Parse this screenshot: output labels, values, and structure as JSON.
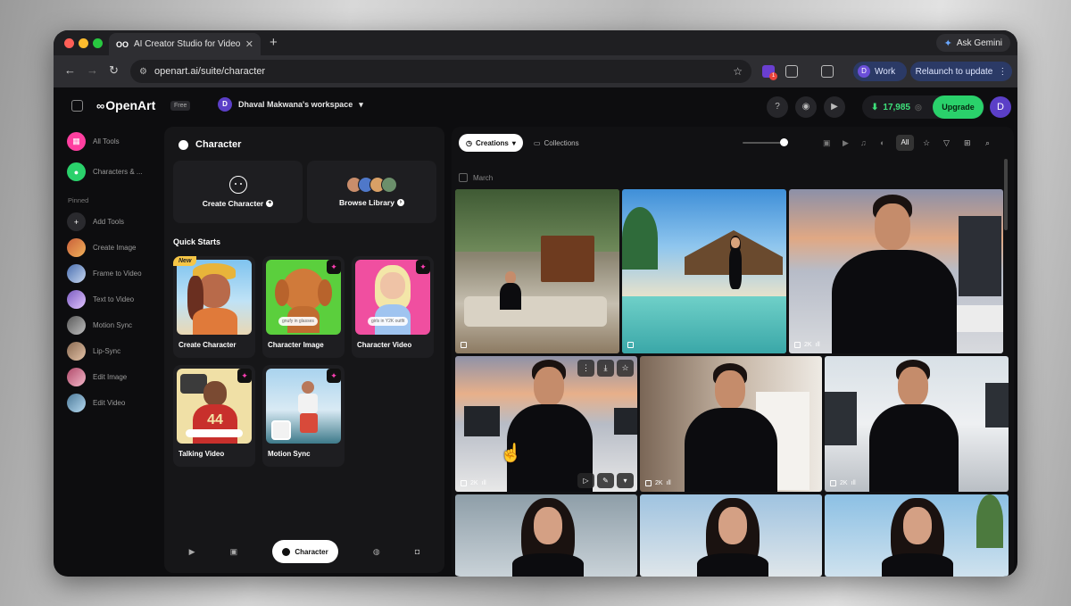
{
  "browser": {
    "tab_title": "AI Creator Studio for Video &",
    "tab_favicon": "OO",
    "url": "openart.ai/suite/character",
    "gemini_label": "Ask Gemini",
    "profile_initial": "D",
    "profile_label": "Work",
    "relaunch_label": "Relaunch to update",
    "ext_badge": "1"
  },
  "app": {
    "logo": "OpenArt",
    "plan_badge": "Free",
    "workspace_initial": "D",
    "workspace_name": "Dhaval Makwana's workspace",
    "credits": "17,985",
    "upgrade_label": "Upgrade",
    "user_initial": "D"
  },
  "rail": {
    "all_tools": "All Tools",
    "characters": "Characters & ...",
    "pinned_label": "Pinned",
    "items": [
      "Add Tools",
      "Create Image",
      "Frame to Video",
      "Text to Video",
      "Motion Sync",
      "Lip-Sync",
      "Edit Image",
      "Edit Video"
    ]
  },
  "panel": {
    "title": "Character",
    "create_character": "Create Character",
    "browse_library": "Browse Library",
    "quick_starts": "Quick Starts",
    "new_badge": "New",
    "cards": [
      "Create Character",
      "Character Image",
      "Character Video",
      "Talking Video",
      "Motion Sync"
    ],
    "chip_image": "gnufy in glasses",
    "chip_video": "girls in Y2K outfit",
    "bottom_active": "Character"
  },
  "creations": {
    "tab_creations": "Creations",
    "tab_collections": "Collections",
    "filter_all": "All",
    "month": "March",
    "tag_2k": "2K"
  },
  "colors": {
    "accent_green": "#2ad16b",
    "brand_purple": "#5b3fc7",
    "pin_pink": "#ff3fb4"
  }
}
